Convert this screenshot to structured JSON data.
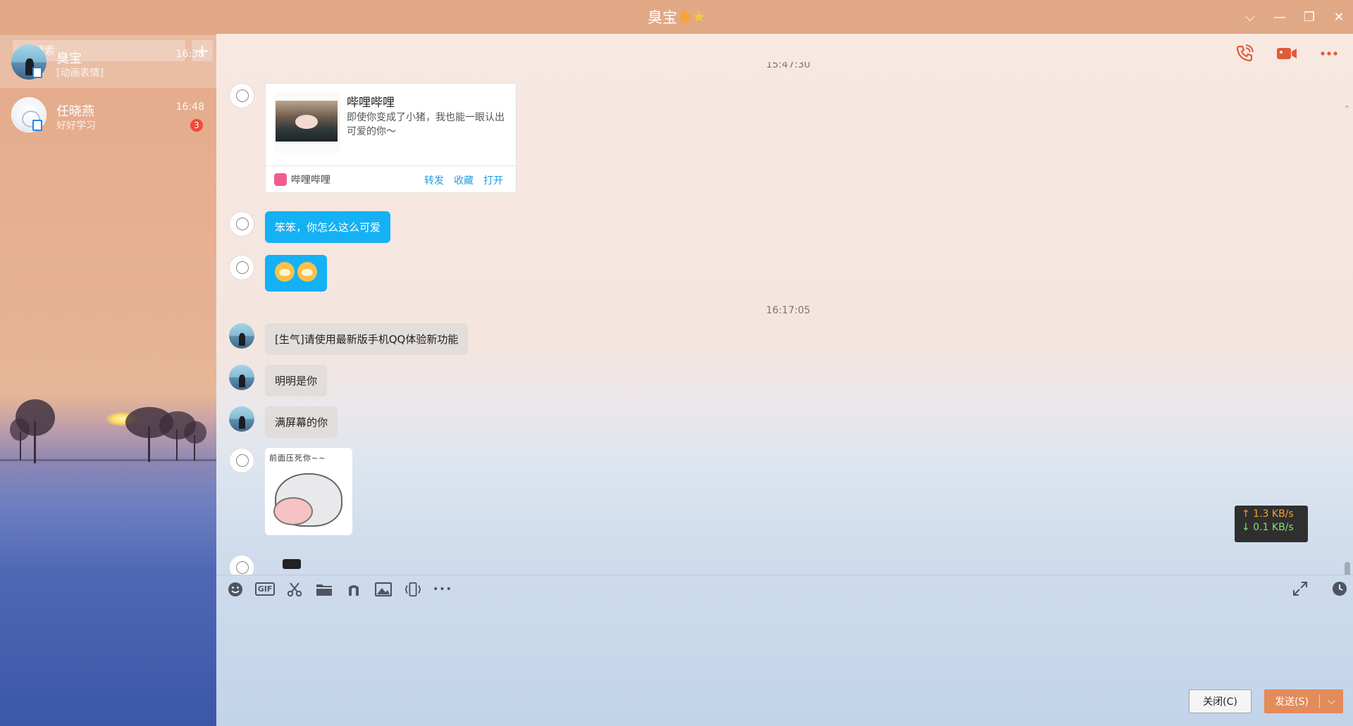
{
  "window": {
    "title": "臭宝",
    "controls": {
      "dropdown": "⌵",
      "minimize": "—",
      "restore": "❐",
      "close": "✕"
    }
  },
  "search": {
    "placeholder": "搜索",
    "add_label": "+"
  },
  "contacts": [
    {
      "name": "臭宝",
      "preview": "[动画表情]",
      "time": "16:38",
      "unread": ""
    },
    {
      "name": "任晓燕",
      "preview": "好好学习",
      "time": "16:48",
      "unread": "3"
    }
  ],
  "chat": {
    "timestamps": {
      "first": "15:47:30",
      "second": "16:17:05"
    },
    "share_card": {
      "title": "哔哩哔哩",
      "description": "即使你变成了小猪，我也能一眼认出可爱的你～",
      "source": "哔哩哔哩",
      "actions": [
        "转发",
        "收藏",
        "打开"
      ]
    },
    "messages": {
      "m1": "笨笨，你怎么这么可爱",
      "m2": "[生气]请使用最新版手机QQ体验新功能",
      "m3": "明明是你",
      "m4": "满屏幕的你"
    },
    "sticker_caption": "前面压死你~~",
    "network_speed": {
      "up": "↑  1.3 KB/s",
      "down": "↓  0.1 KB/s"
    }
  },
  "input": {
    "toolbar_icons": [
      "smile-icon",
      "gif-icon",
      "scissors-icon",
      "folder-icon",
      "music-icon",
      "image-icon",
      "shake-icon",
      "more-icon"
    ],
    "gif_label": "GIF",
    "more_label": "•••"
  },
  "buttons": {
    "close": "关闭(C)",
    "send": "发送(S)"
  },
  "colors": {
    "title_bar": "#e1a886",
    "accent_blue": "#15b1f5",
    "send_button": "#e38c5b",
    "unread_badge": "#f04a3b"
  }
}
